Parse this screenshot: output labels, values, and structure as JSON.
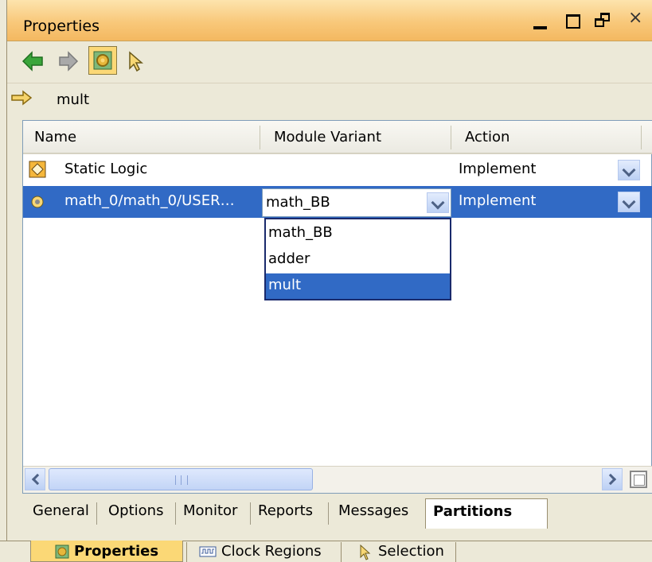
{
  "window": {
    "title": "Properties",
    "controls": {
      "close_glyph": "×"
    }
  },
  "toolbar": {
    "icons": [
      "arrow-left-icon",
      "arrow-right-icon",
      "settings-icon",
      "cursor-icon"
    ]
  },
  "breadcrumb": {
    "text": "mult"
  },
  "table": {
    "columns": [
      "Name",
      "Module Variant",
      "Action"
    ],
    "rows": [
      {
        "name": "Static Logic",
        "module_variant": "",
        "action": "Implement"
      },
      {
        "name": "math_0/math_0/USER…",
        "module_variant": "math_BB",
        "action": "Implement"
      }
    ]
  },
  "dropdown": {
    "options": [
      "math_BB",
      "adder",
      "mult"
    ],
    "selected": "mult"
  },
  "property_tabs": [
    "General",
    "Options",
    "Monitor",
    "Reports",
    "Messages",
    "Partitions"
  ],
  "active_property_tab": "Partitions",
  "bottom_tabs": [
    "Properties",
    "Clock Regions",
    "Selection"
  ],
  "active_bottom_tab": "Properties",
  "colors": {
    "titlebar": "#f8c87a",
    "selection": "#316ac5",
    "active_bottom_tab": "#fbd876"
  }
}
